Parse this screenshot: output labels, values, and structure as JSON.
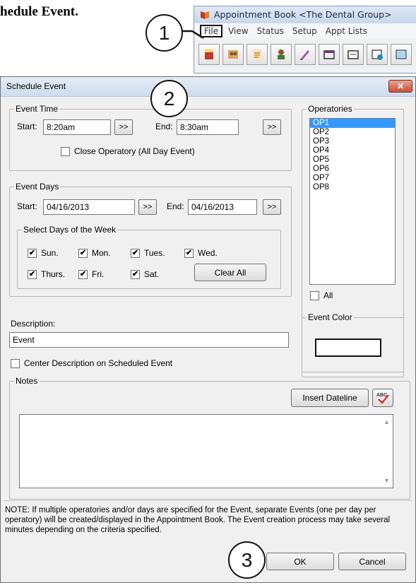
{
  "doc": {
    "fragment": "hedule Event."
  },
  "app": {
    "title": "Appointment Book <The Dental Group>",
    "menu": [
      "File",
      "View",
      "Status",
      "Setup",
      "Appt Lists"
    ],
    "toolbar_icons": [
      "tooth-chart-icon",
      "family-icon",
      "notes-icon",
      "patient-icon",
      "edit-icon",
      "window-icon",
      "blank-icon",
      "schedule-icon",
      "image-icon"
    ]
  },
  "callouts": {
    "one": "1",
    "two": "2",
    "three": "3"
  },
  "dialog": {
    "title": "Schedule Event",
    "close_label": "✕",
    "event_time": {
      "legend": "Event Time",
      "start_label": "Start:",
      "start_value": "8:20am",
      "end_label": "End:",
      "end_value": "8:30am",
      "more_label": ">>",
      "close_operatory_label": "Close Operatory (All Day Event)",
      "close_operatory_checked": false
    },
    "event_days": {
      "legend": "Event Days",
      "start_label": "Start:",
      "start_value": "04/16/2013",
      "end_label": "End:",
      "end_value": "04/16/2013",
      "more_label": ">>"
    },
    "days_of_week": {
      "legend": "Select Days of the Week",
      "days": [
        {
          "label": "Sun.",
          "checked": true
        },
        {
          "label": "Mon.",
          "checked": true
        },
        {
          "label": "Tues.",
          "checked": true
        },
        {
          "label": "Wed.",
          "checked": true
        },
        {
          "label": "Thurs.",
          "checked": true
        },
        {
          "label": "Fri.",
          "checked": true
        },
        {
          "label": "Sat.",
          "checked": true
        }
      ],
      "clear_all_label": "Clear All"
    },
    "operatories": {
      "legend": "Operatories",
      "items": [
        "OP1",
        "OP2",
        "OP3",
        "OP4",
        "OP5",
        "OP6",
        "OP7",
        "OP8"
      ],
      "selected": "OP1",
      "all_label": "All",
      "all_checked": false
    },
    "description": {
      "label": "Description:",
      "value": "Event",
      "center_label": "Center Description on Scheduled Event",
      "center_checked": false
    },
    "event_color": {
      "legend": "Event Color",
      "color": "#ffffff"
    },
    "notes": {
      "legend": "Notes",
      "insert_dateline_label": "Insert Dateline",
      "value": ""
    },
    "note": "NOTE: If multiple operatories and/or days are specified for the Event, separate Events (one per day per operatory) will be created/displayed in the Appointment Book.  The Event creation process may take several minutes depending on the criteria specified.",
    "ok_label": "OK",
    "cancel_label": "Cancel",
    "check_mark": "✔"
  },
  "colors": {
    "selection": "#3399ff",
    "close_button": "#c7523c"
  }
}
